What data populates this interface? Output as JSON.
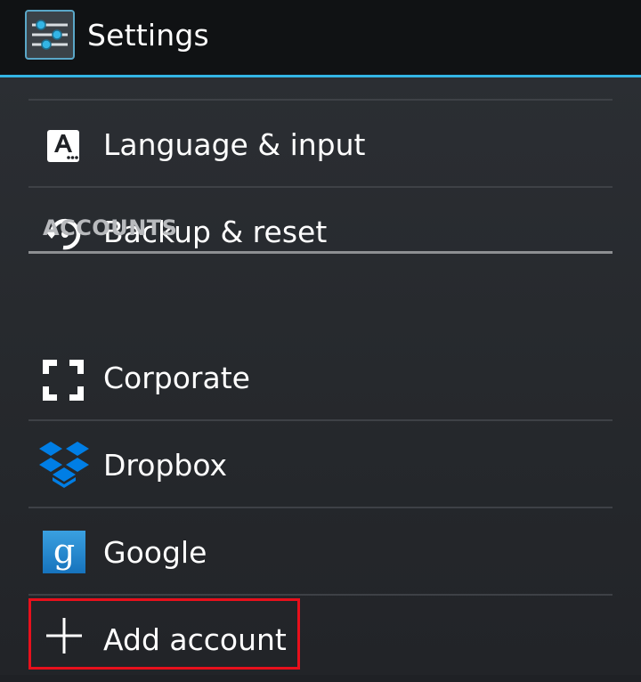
{
  "action_bar": {
    "title": "Settings",
    "icon": "settings-sliders-icon",
    "accent_color": "#33b5e5"
  },
  "items": [
    {
      "label": "Language & input",
      "icon": "language-icon"
    },
    {
      "label": "Backup & reset",
      "icon": "backup-restore-icon"
    }
  ],
  "accounts_section": {
    "header": "ACCOUNTS",
    "items": [
      {
        "label": "Corporate",
        "icon": "corporate-icon"
      },
      {
        "label": "Dropbox",
        "icon": "dropbox-icon",
        "color": "#007ee5"
      },
      {
        "label": "Google",
        "icon": "google-icon",
        "color": "#1e88cf"
      },
      {
        "label": "Add account",
        "icon": "plus-icon"
      }
    ]
  },
  "highlight_color": "#e8101c"
}
